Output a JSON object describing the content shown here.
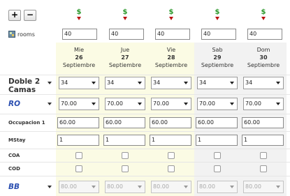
{
  "toolbar": {
    "plus_label": "+",
    "minus_label": "−"
  },
  "rooms": {
    "label": "rooms",
    "values": [
      "40",
      "40",
      "40",
      "40",
      "40"
    ]
  },
  "dates": [
    {
      "weekday": "Mie",
      "day": "26",
      "month": "Septiembre"
    },
    {
      "weekday": "Jue",
      "day": "27",
      "month": "Septiembre"
    },
    {
      "weekday": "Vie",
      "day": "28",
      "month": "Septiembre"
    },
    {
      "weekday": "Sab",
      "day": "29",
      "month": "Septiembre"
    },
    {
      "weekday": "Dom",
      "day": "30",
      "month": "Septiembre"
    }
  ],
  "room_type": {
    "label": "Doble 2 Camas",
    "values": [
      "34",
      "34",
      "34",
      "34",
      "34"
    ]
  },
  "ro": {
    "label": "RO",
    "values": [
      "70.00",
      "70.00",
      "70.00",
      "70.00",
      "70.00"
    ]
  },
  "occupancy": {
    "label": "Occupacion 1",
    "values": [
      "60.00",
      "60.00",
      "60.00",
      "60.00",
      "60.00"
    ]
  },
  "mstay": {
    "label": "MStay",
    "values": [
      "1",
      "1",
      "1",
      "1",
      "1"
    ]
  },
  "coa": {
    "label": "COA"
  },
  "cod": {
    "label": "COD"
  },
  "bb": {
    "label": "BB",
    "values": [
      "80.00",
      "80.00",
      "80.00",
      "80.00",
      "80.00"
    ]
  },
  "colors": {
    "weekday_bg": "#fbfbe4",
    "weekend_bg": "#f2f2f2",
    "dollar": "#2e9a2e",
    "arrow": "#b11111",
    "blue_label": "#2a4eb0"
  },
  "icons": {
    "price_marker": "dollar-down-arrow-icon",
    "rooms": "rooms-icon"
  }
}
